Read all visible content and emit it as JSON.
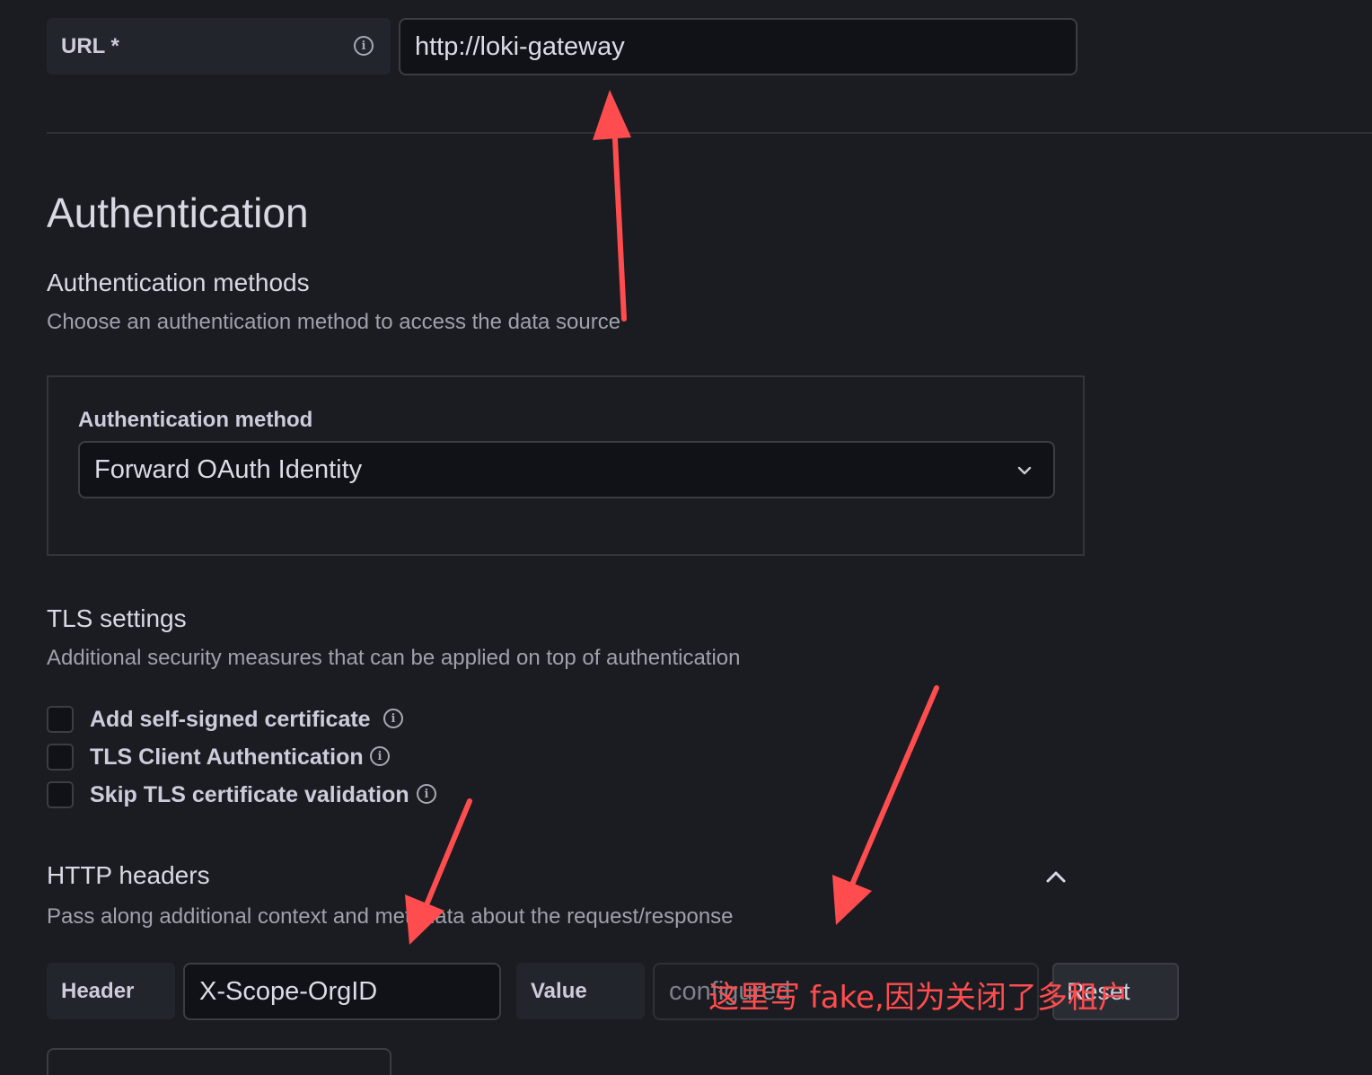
{
  "url_field": {
    "label": "URL *",
    "value": "http://loki-gateway"
  },
  "authentication": {
    "title": "Authentication",
    "methods_title": "Authentication methods",
    "methods_desc": "Choose an authentication method to access the data source",
    "method_label": "Authentication method",
    "method_value": "Forward OAuth Identity"
  },
  "tls": {
    "title": "TLS settings",
    "desc": "Additional security measures that can be applied on top of authentication",
    "options": [
      {
        "label": "Add self-signed certificate",
        "checked": false
      },
      {
        "label": "TLS Client Authentication",
        "checked": false
      },
      {
        "label": "Skip TLS certificate validation",
        "checked": false
      }
    ]
  },
  "http_headers": {
    "title": "HTTP headers",
    "desc": "Pass along additional context and metadata about the request/response",
    "header_label": "Header",
    "header_value": "X-Scope-OrgID",
    "value_label": "Value",
    "value_placeholder": "configured",
    "reset_label": "Reset"
  },
  "annotation": {
    "text": "这里写 fake,因为关闭了多租户",
    "color": "#ff4d4f"
  },
  "icons": {
    "info": "info-circle-icon",
    "chevron_down": "chevron-down-icon",
    "chevron_up": "chevron-up-icon"
  }
}
